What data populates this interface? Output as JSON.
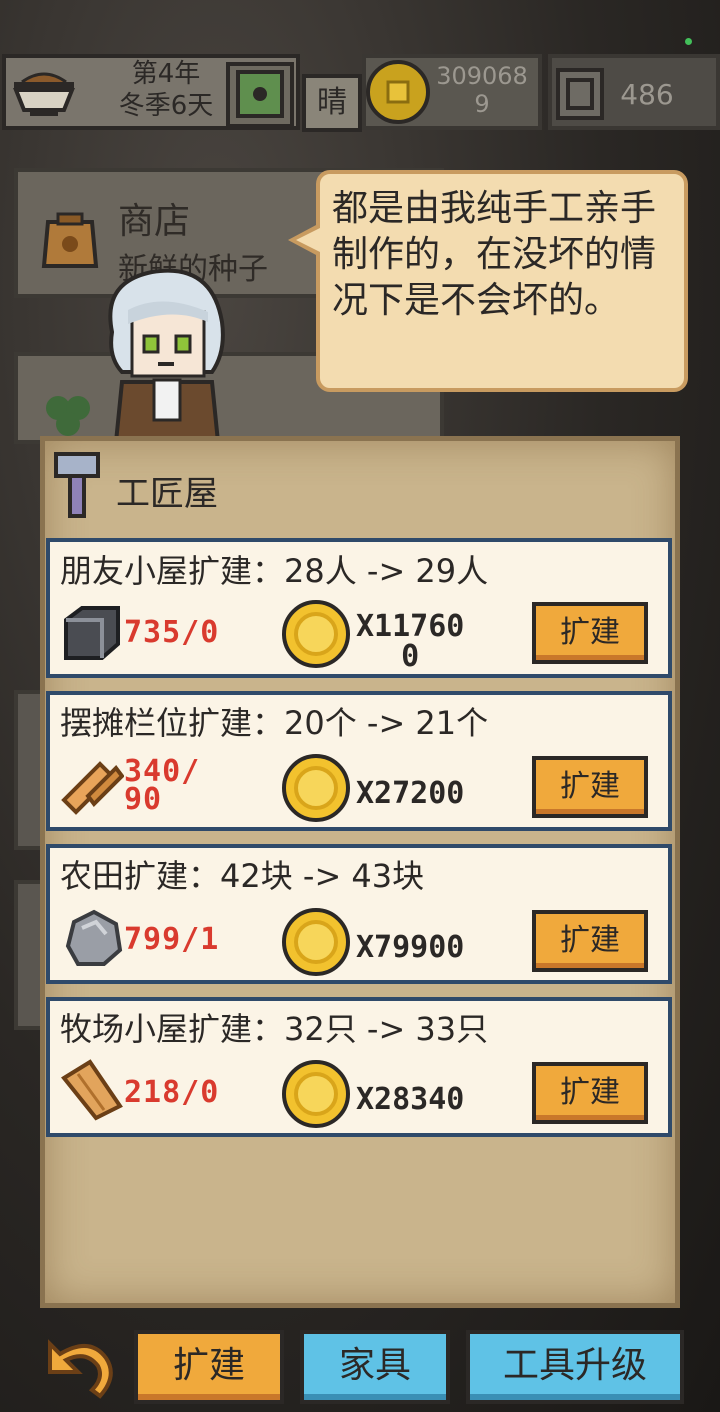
{
  "status_bar": {
    "date_line1": "第4年",
    "date_line2": "冬季6天",
    "weather": "晴",
    "gold_line1": "309068",
    "gold_line2": "9",
    "gems": "486"
  },
  "background_menu": {
    "shop_title": "商店",
    "shop_subtitle": "新鲜的种子"
  },
  "speech_bubble": {
    "text": "都是由我纯手工亲手制作的，在没坏的情况下是不会坏的。"
  },
  "panel": {
    "title": "工匠屋",
    "items": [
      {
        "title": "朋友小屋扩建：28人 -> 29人",
        "material_icon": "iron-ingot-icon",
        "material_count": "735/0",
        "price_line1": "X11760",
        "price_line2": "0",
        "button_label": "扩建"
      },
      {
        "title": "摆摊栏位扩建：20个 -> 21个",
        "material_icon": "wood-log-icon",
        "material_count_line1": "340/",
        "material_count_line2": "90",
        "price": "X27200",
        "button_label": "扩建"
      },
      {
        "title": "农田扩建：42块 -> 43块",
        "material_icon": "stone-icon",
        "material_count": "799/1",
        "price": "X79900",
        "button_label": "扩建"
      },
      {
        "title": "牧场小屋扩建：32只 -> 33只",
        "material_icon": "wood-plank-icon",
        "material_count": "218/0",
        "price": "X28340",
        "button_label": "扩建"
      }
    ]
  },
  "bottom_tabs": {
    "expand": "扩建",
    "furniture": "家具",
    "tool_upgrade": "工具升级"
  },
  "colors": {
    "button_orange": "#f0a93c",
    "button_blue": "#5fc2e6",
    "material_red": "#d93a2e",
    "parchment": "#c9b48c",
    "card_border": "#2f4a6a"
  }
}
